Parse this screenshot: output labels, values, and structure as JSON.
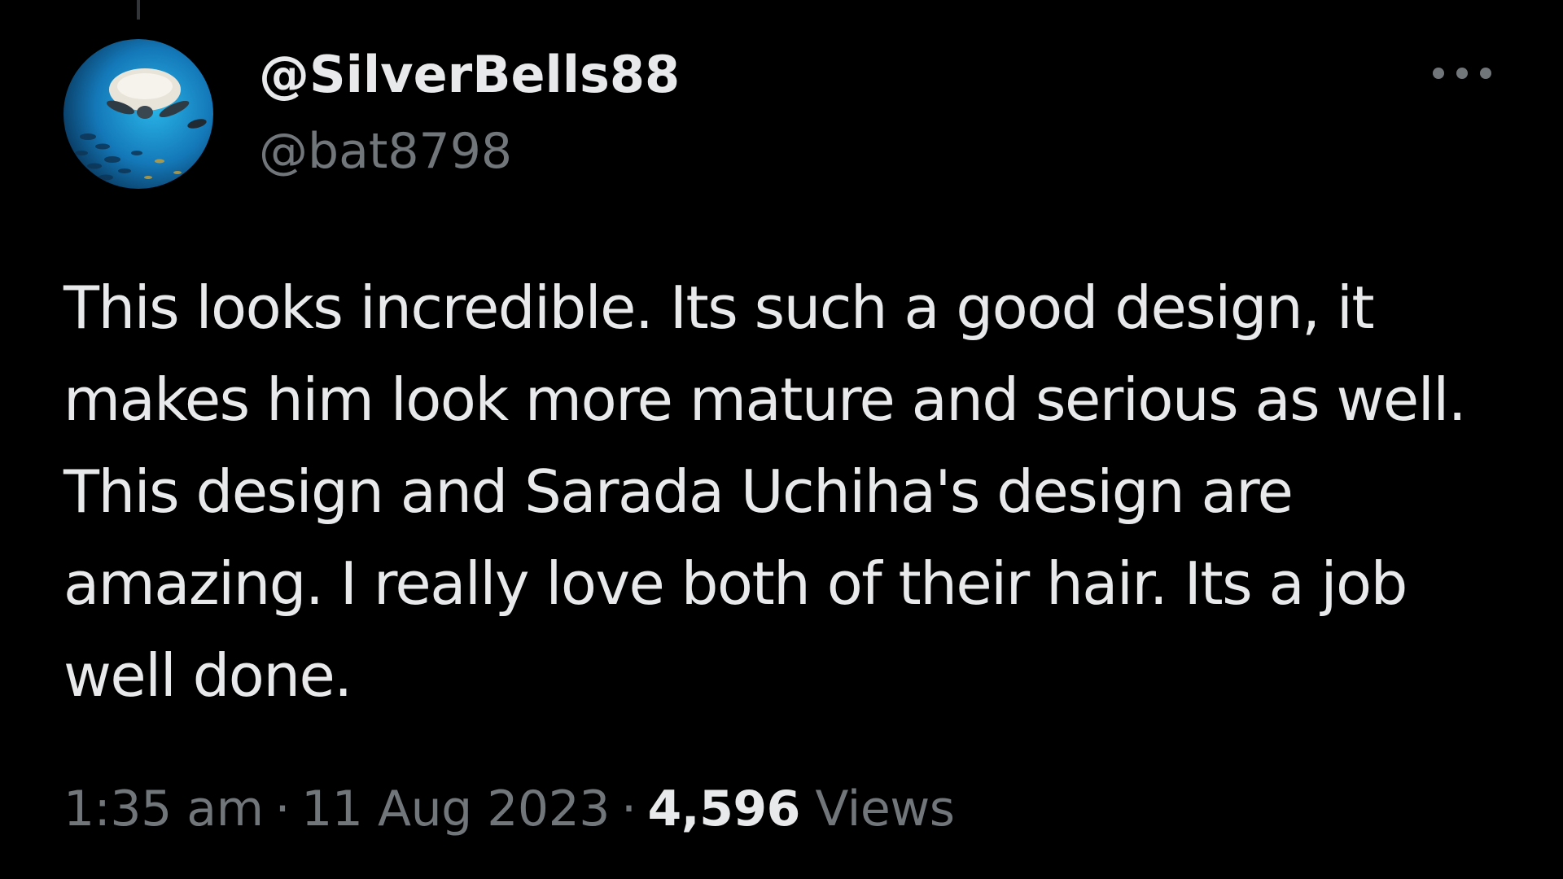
{
  "colors": {
    "background": "#000000",
    "primary_text": "#e7e9ea",
    "secondary_text": "#71767b"
  },
  "author": {
    "display_name": "@SilverBells88",
    "handle": "@bat8798",
    "avatar_icon": "profile-photo-sea-turtle"
  },
  "more_icon": "more-horizontal-icon",
  "tweet": {
    "text_lines": [
      "This looks incredible. Its such a good design, it",
      "makes him look more mature and serious as well.",
      "This design and Sarada Uchiha's design are",
      "amazing. I really love both of their hair. Its a job",
      "well done."
    ]
  },
  "meta": {
    "time": "1:35 am",
    "separator": "·",
    "date": "11 Aug 2023",
    "views_count": "4,596",
    "views_label": "Views"
  }
}
